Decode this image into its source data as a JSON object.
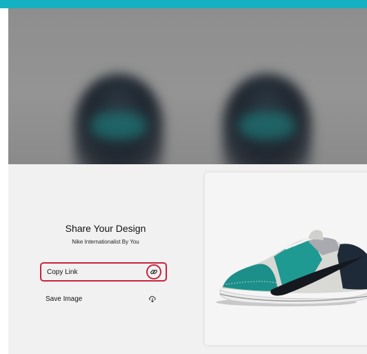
{
  "share": {
    "title": "Share Your Design",
    "subtitle": "Nike Internationalist By You",
    "copy_link_label": "Copy Link",
    "save_image_label": "Save Image",
    "copy_icon": "link-icon",
    "save_icon": "download-icon"
  },
  "colors": {
    "top_bar": "#14b1c2",
    "highlight": "#c8213f",
    "shoe_teal": "#1d8f8a",
    "shoe_navy": "#1f2a38"
  }
}
